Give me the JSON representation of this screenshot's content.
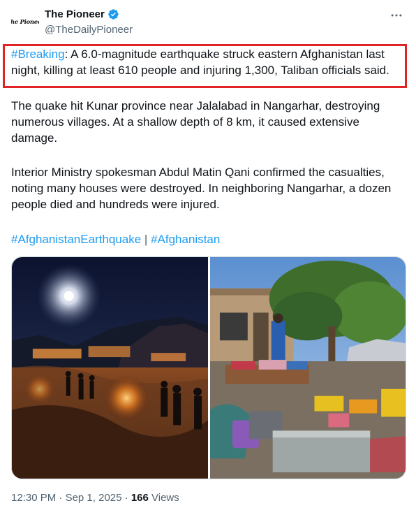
{
  "account": {
    "display_name": "The Pioneer",
    "handle": "@TheDailyPioneer",
    "avatar_text": "The Pioneer",
    "verified": true
  },
  "more_icon": "more-horizontal-icon",
  "tweet": {
    "lead_hashtag": "#Breaking",
    "lead_text": ": A 6.0-magnitude earthquake struck eastern Afghanistan last night, killing at least 610 people and injuring 1,300, Taliban officials said.",
    "paragraph_2": "The quake hit Kunar province near Jalalabad in Nangarhar, destroying numerous villages. At a shallow depth of 8 km, it caused extensive damage.",
    "paragraph_3": "Interior Ministry spokesman Abdul Matin Qani confirmed the casualties, noting many houses were destroyed. In neighboring Nangarhar, a dozen people died and hundreds were injured.",
    "hashtag_1": "#AfghanistanEarthquake",
    "separator": " | ",
    "hashtag_2": "#Afghanistan"
  },
  "meta": {
    "time": "12:30 PM",
    "dot": " · ",
    "date": "Sep 1, 2025",
    "views_count": "166",
    "views_label": " Views"
  },
  "colors": {
    "link": "#1d9bf0",
    "verified": "#1d9bf0",
    "highlight_border": "#e02424",
    "text": "#0f1419",
    "secondary": "#536471"
  }
}
